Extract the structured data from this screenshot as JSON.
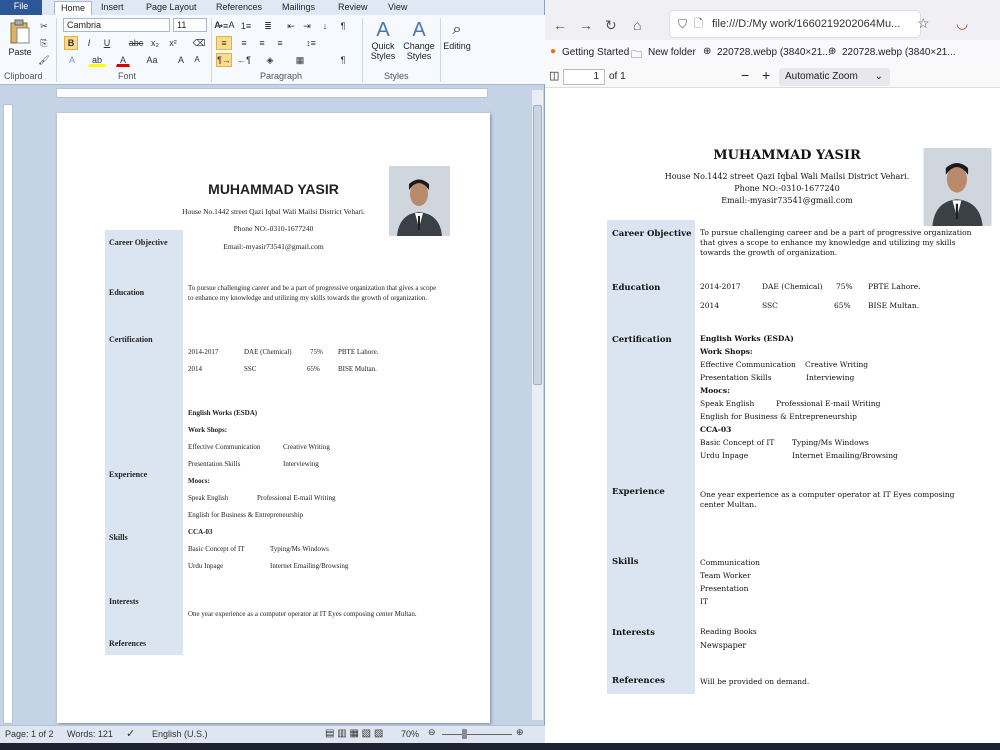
{
  "word": {
    "tabs": [
      "File",
      "Home",
      "Insert",
      "Page Layout",
      "References",
      "Mailings",
      "Review",
      "View"
    ],
    "font_name": "Cambria",
    "font_size": "11",
    "paste_label": "Paste",
    "groups": [
      "Clipboard",
      "Font",
      "Paragraph",
      "Styles"
    ],
    "quick_styles": "Quick Styles",
    "change_styles": "Change Styles",
    "editing": "Editing",
    "status": {
      "page": "Page: 1 of 2",
      "words": "Words: 121",
      "language": "English (U.S.)",
      "zoom": "70%"
    }
  },
  "resume": {
    "name": "MUHAMMAD YASIR",
    "address": "House No.1442 street Qazi Iqbal Wali Mailsi District Vehari.",
    "phone": "Phone NO:-0310-1677240",
    "email": "Email:-myasir73541@gmail.com",
    "labels": {
      "career": "Career Objective",
      "education": "Education",
      "certification": "Certification",
      "experience": "Experience",
      "skills": "Skills",
      "interests": "Interests",
      "references": "References"
    },
    "career_text": "To pursue challenging career and be a part of progressive organization that gives a scope to enhance my knowledge and utilizing my skills towards the growth of organization.",
    "edu_1": [
      "2014-2017",
      "DAE (Chemical)",
      "75%",
      "PBTE Lahore."
    ],
    "edu_2": [
      "2014",
      "SSC",
      "65%",
      "BISE Multan."
    ],
    "cert": {
      "english_works": "English Works  (ESDA)",
      "work_shops": "Work Shops:",
      "effective": "Effective Communication",
      "creative": "Creative Writing",
      "presentation": "Presentation Skills",
      "interviewing": "Interviewing",
      "moocs": "Moocs:",
      "speak": "Speak English",
      "prof_email": "Professional E-mail Writing",
      "business": "English for Business & Entrepreneurship",
      "cca": "CCA-03",
      "basic_it": "Basic Concept of IT",
      "typing": "Typing/Ms Windows",
      "urdu": "Urdu Inpage",
      "internet": "Internet Emailing/Browsing"
    },
    "experience_text": "One year experience as a computer operator at IT Eyes composing center Multan.",
    "skills": [
      "Communication",
      "Team Worker",
      "Presentation",
      "IT"
    ],
    "interests": [
      "Reading Books",
      "Newspaper"
    ],
    "references_text": "Will be provided on demand."
  },
  "browser": {
    "url": "file:///D:/My work/1660219202064Mu...",
    "bookmarks": [
      "Getting Started",
      "New folder",
      "220728.webp (3840×21...",
      "220728.webp (3840×21..."
    ],
    "page_num": "1",
    "page_total": "of 1",
    "zoom": "Automatic Zoom"
  }
}
